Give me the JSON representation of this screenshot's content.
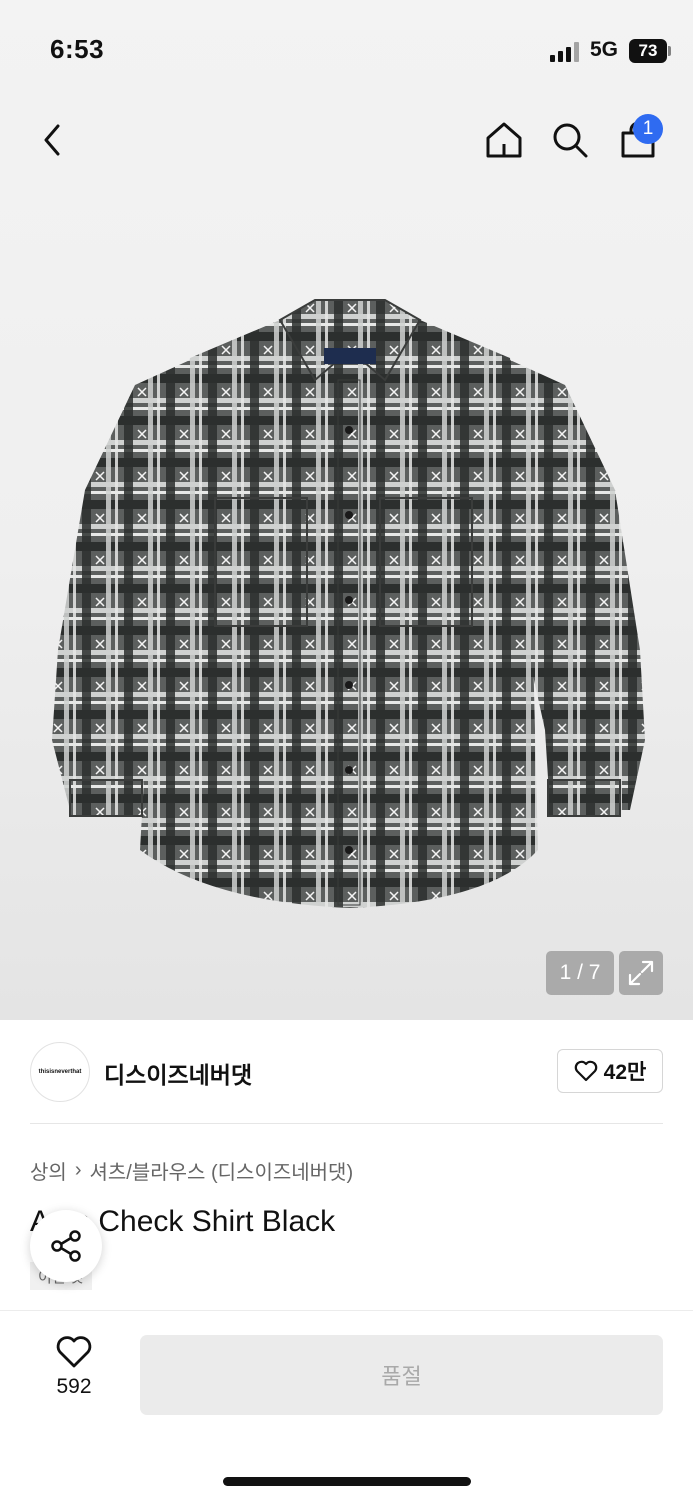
{
  "status": {
    "time": "6:53",
    "network": "5G",
    "battery": "73"
  },
  "cart": {
    "count": "1"
  },
  "gallery": {
    "counter": "1 / 7"
  },
  "brand": {
    "logo_text": "thisisneverthat",
    "name": "디스이즈네버댓",
    "likes": "42만"
  },
  "breadcrumb": {
    "category": "상의",
    "separator": "›",
    "subcategory": "셔츠/블라우스 (디스이즈네버댓)"
  },
  "product": {
    "title": "A    an Check Shirt Black",
    "tag": "이번 것"
  },
  "bottom": {
    "wish_count": "592",
    "soldout_label": "품절"
  },
  "colors": {
    "accent": "#2f6bf1",
    "soldout_bg": "#ebebeb",
    "soldout_text": "#a9a9a9"
  }
}
